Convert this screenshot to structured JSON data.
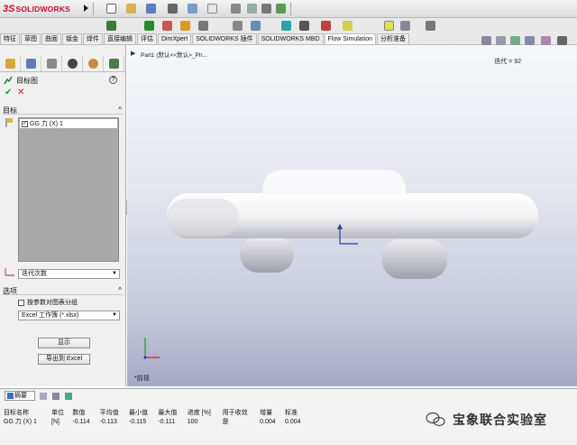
{
  "app": {
    "logo_ds": "3S",
    "logo_text": "SOLIDWORKS"
  },
  "command_tabs": [
    "特征",
    "草图",
    "曲面",
    "钣金",
    "焊件",
    "直接编辑",
    "评估",
    "DimXpert",
    "SOLIDWORKS 插件",
    "SOLIDWORKS MBD",
    "Flow Simulation",
    "分析准备"
  ],
  "active_tab_index": 10,
  "property_manager": {
    "title": "目标图",
    "help": "?",
    "ok": "✔",
    "cancel": "✕",
    "goals_section": "目标",
    "goal_items": [
      {
        "label": "GG 力 (X) 1",
        "checked": true
      }
    ],
    "x_axis_select": "迭代次数",
    "options_section": "选项",
    "split_by_param_label": "按参数对图表分组",
    "split_by_param_checked": false,
    "export_format_select": "Excel 工作簿 (*.xlsx)",
    "show_button": "显示",
    "export_button": "导出到 Excel",
    "collapse_chevron": "^"
  },
  "viewport": {
    "breadcrumb": "Part1  (默认<<默认>_Ph...",
    "iteration_label": "迭代 = 92",
    "view_name": "*前视"
  },
  "bottom_panel": {
    "summary_select": "摘要",
    "table_headers": [
      "目标名称",
      "单位",
      "数值",
      "平均值",
      "最小值",
      "最大值",
      "进度 [%]",
      "用于收敛",
      "增量",
      "标准"
    ],
    "table_rows": [
      [
        "GG 力 (X) 1",
        "[N]",
        "-0.114",
        "-0.113",
        "-0.115",
        "-0.111",
        "100",
        "是",
        "0.004",
        "0.004"
      ]
    ]
  },
  "watermark": {
    "text": "宝象联合实验室"
  },
  "colors": {
    "logo_red": "#c8102e",
    "ok_green": "#2a9a2a",
    "cancel_red": "#c02020",
    "viewport_bottom": "#a4a9c6"
  }
}
